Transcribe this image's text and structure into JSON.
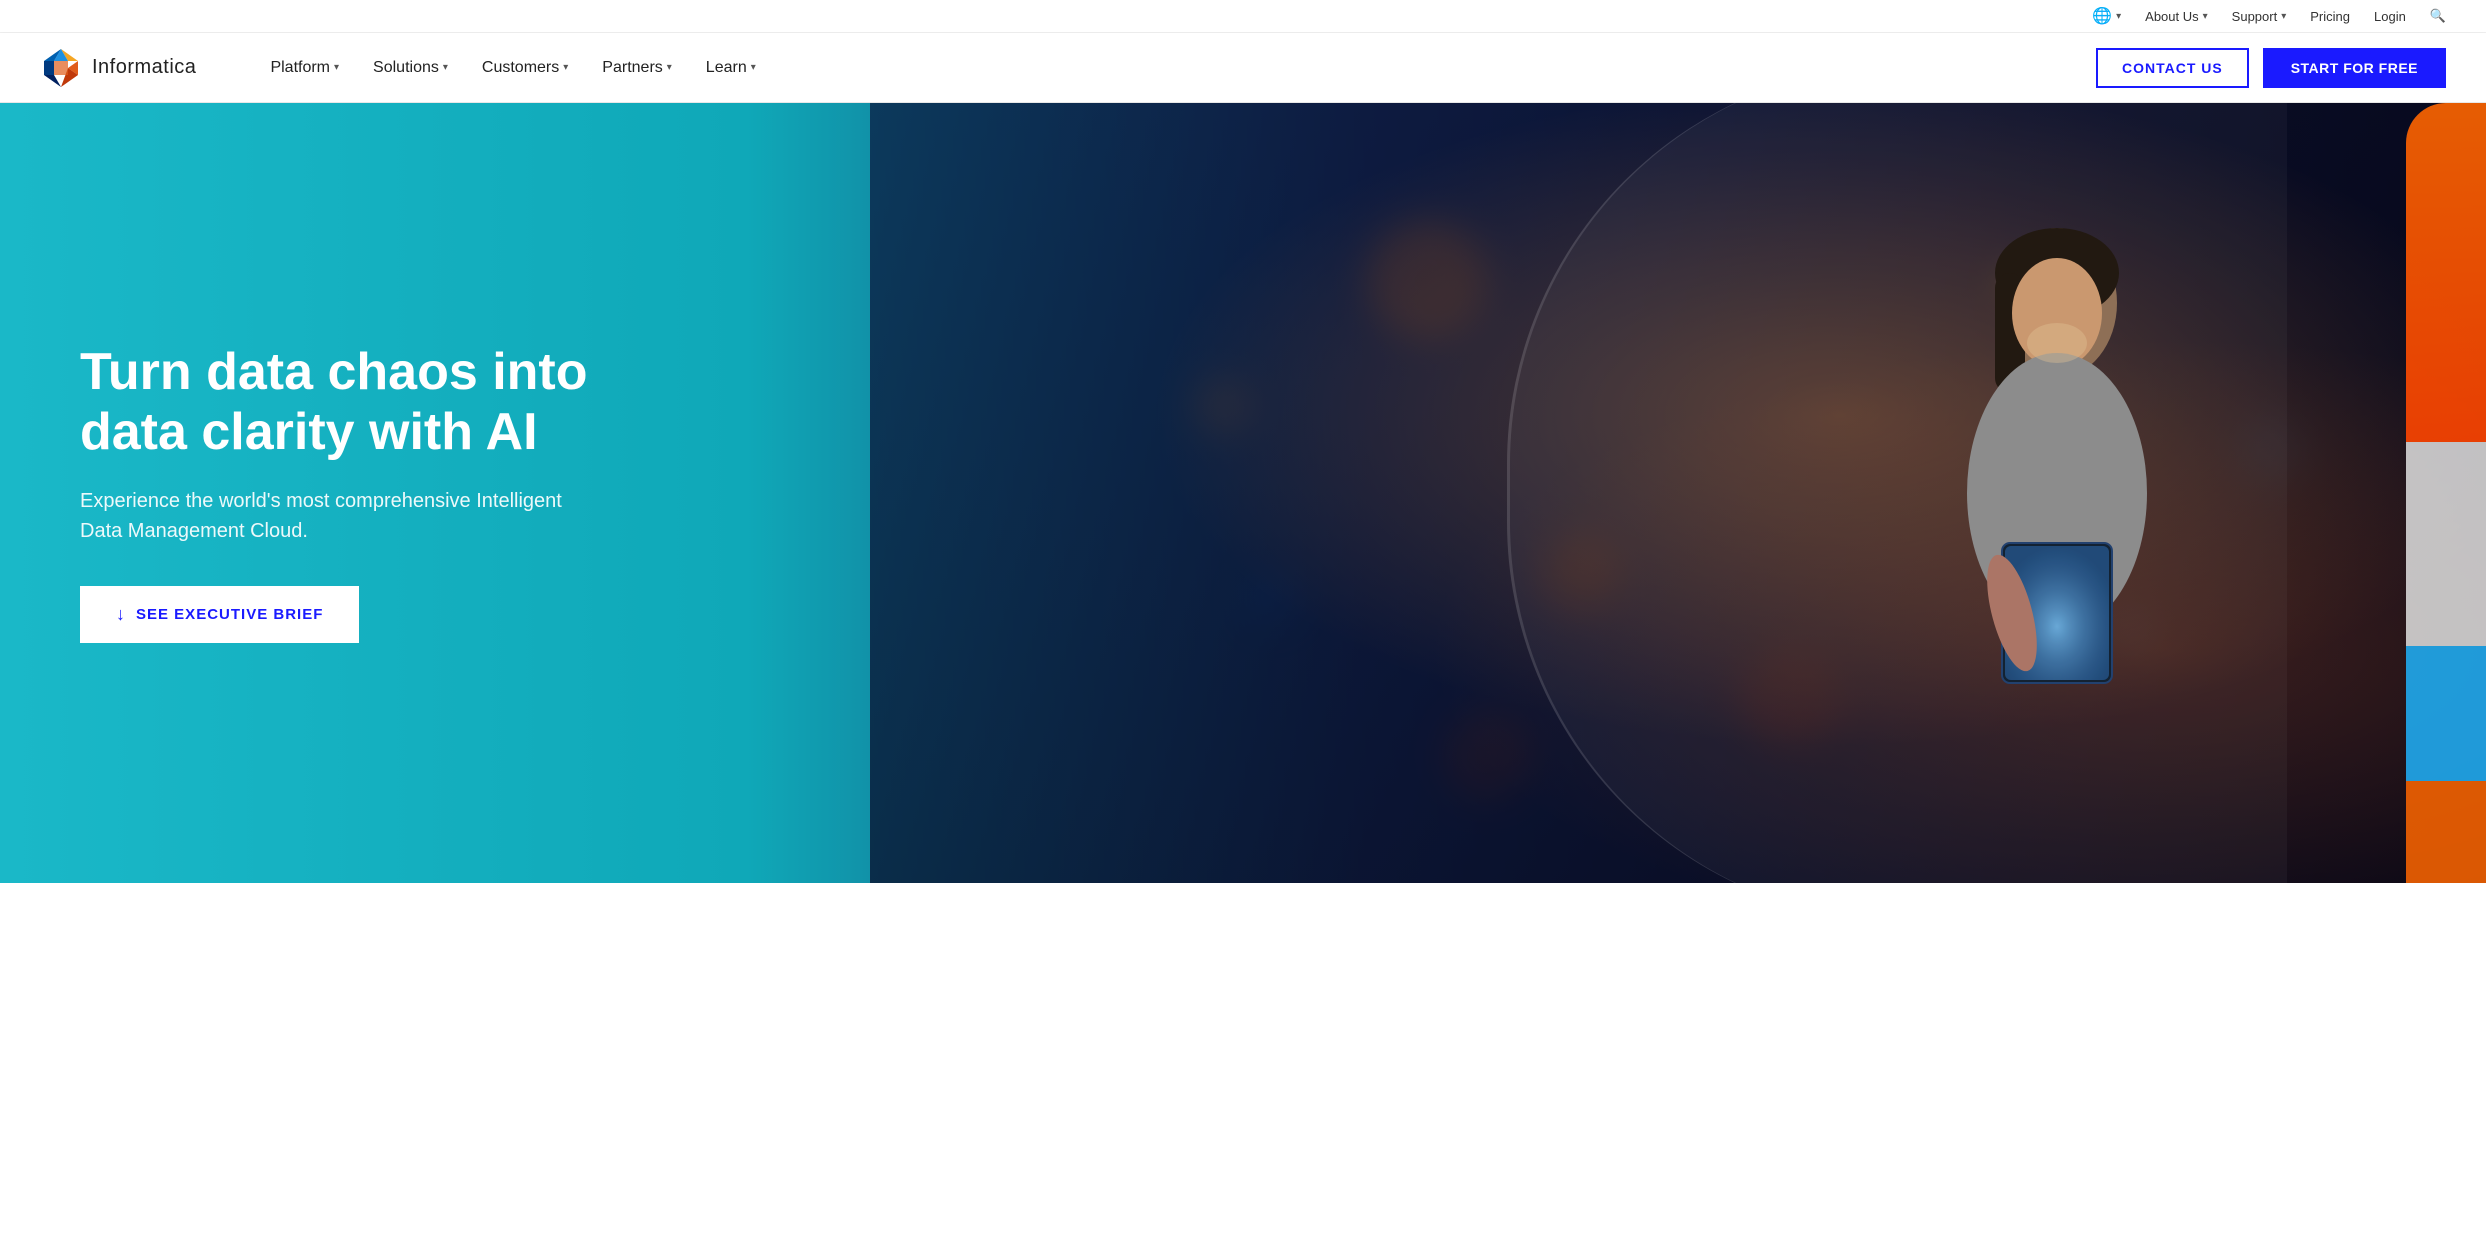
{
  "topbar": {
    "globe_icon": "🌐",
    "language_label": "",
    "about_us_label": "About Us",
    "support_label": "Support",
    "pricing_label": "Pricing",
    "login_label": "Login",
    "search_icon": "🔍"
  },
  "navbar": {
    "logo_text": "Informatica",
    "nav_items": [
      {
        "label": "Platform",
        "has_dropdown": true
      },
      {
        "label": "Solutions",
        "has_dropdown": true
      },
      {
        "label": "Customers",
        "has_dropdown": true
      },
      {
        "label": "Partners",
        "has_dropdown": true
      },
      {
        "label": "Learn",
        "has_dropdown": true
      }
    ],
    "contact_us_label": "CONTACT US",
    "start_for_free_label": "START FOR FREE"
  },
  "hero": {
    "title": "Turn data chaos into data clarity with AI",
    "subtitle": "Experience the world's most comprehensive Intelligent Data Management Cloud.",
    "cta_label": "SEE EXECUTIVE BRIEF",
    "cta_icon": "↓"
  }
}
